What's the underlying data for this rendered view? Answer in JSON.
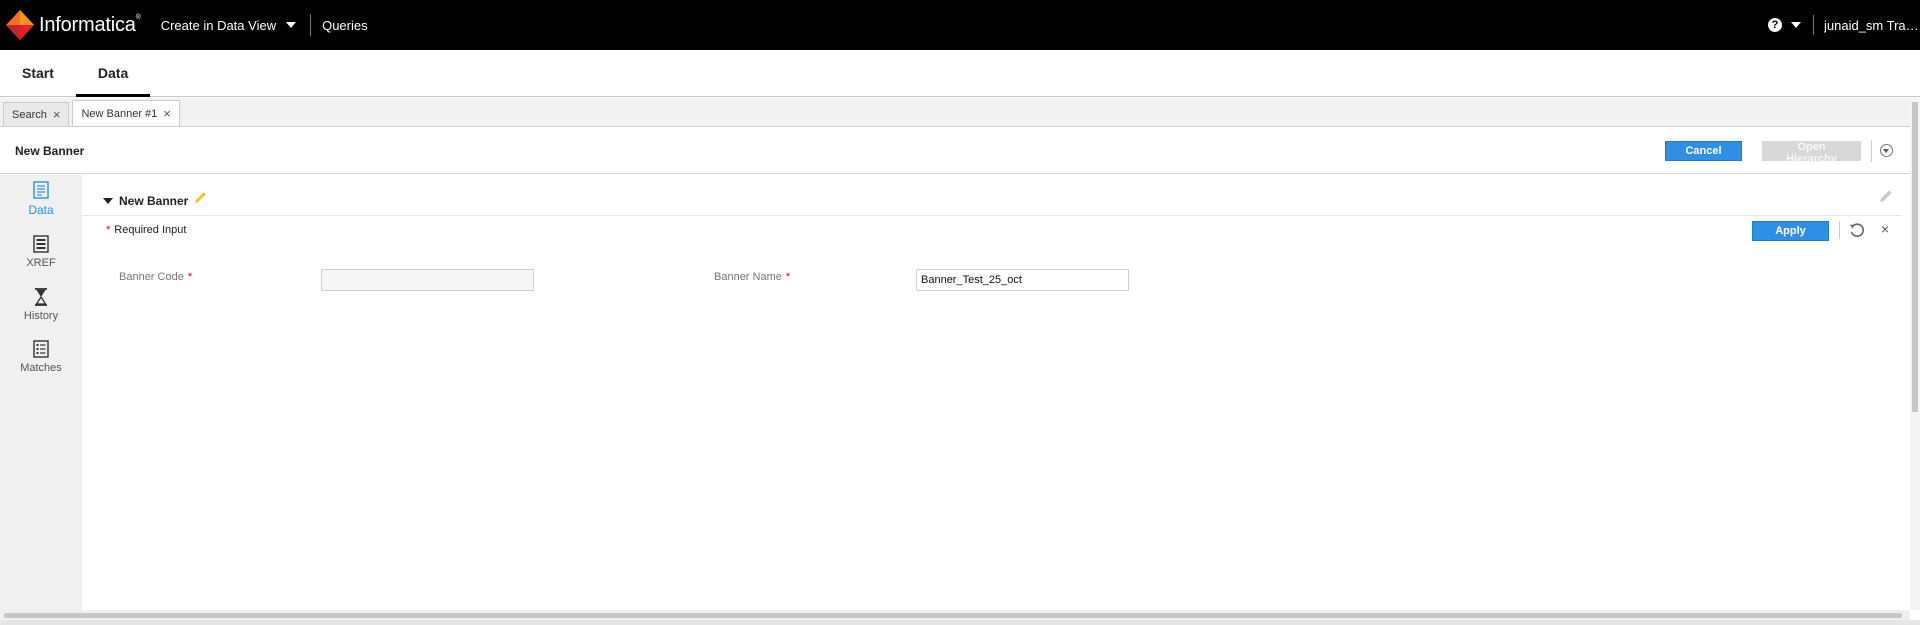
{
  "topbar": {
    "brand": "Informatica",
    "brand_mark": "®",
    "nav": {
      "create_label": "Create in Data View",
      "queries_label": "Queries"
    },
    "help_symbol": "?",
    "user": "junaid_sm Trad..."
  },
  "main_tabs": [
    {
      "label": "Start"
    },
    {
      "label": "Data"
    }
  ],
  "sub_tabs": [
    {
      "label": "Search"
    },
    {
      "label": "New Banner #1"
    }
  ],
  "sub_tab_close": "×",
  "header": {
    "title": "New Banner",
    "cancel_label": "Cancel",
    "open_hierarchy_label": "Open Hierarchy"
  },
  "sidebar": {
    "items": [
      {
        "label": "Data",
        "icon": "document-icon"
      },
      {
        "label": "XREF",
        "icon": "xref-icon"
      },
      {
        "label": "History",
        "icon": "hourglass-icon"
      },
      {
        "label": "Matches",
        "icon": "matches-icon"
      }
    ]
  },
  "section": {
    "title": "New Banner",
    "required_star": "*",
    "required_text": "Required Input",
    "apply_label": "Apply",
    "close_symbol": "×"
  },
  "fields": {
    "banner_code": {
      "label": "Banner Code",
      "star": "*",
      "value": ""
    },
    "banner_name": {
      "label": "Banner Name",
      "star": "*",
      "value": "Banner_Test_25_oct"
    }
  },
  "colors": {
    "accent": "#2e8fe6",
    "required": "#d0021b",
    "topbar": "#000000",
    "pencil": "#f5c518"
  }
}
